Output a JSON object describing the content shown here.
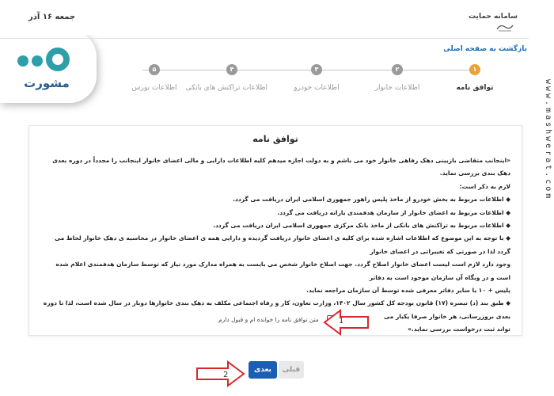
{
  "header": {
    "date": "جمعه ۱۶ آذر",
    "brand": "سامانه حمایت",
    "emblem": "ﻣﺤﺮﻡ"
  },
  "nav": {
    "back_label": "بازگشت به صفحه اصلی"
  },
  "logo": {
    "word": "مشورت"
  },
  "watermark": "www.mashwerat.com",
  "stepper": {
    "steps": [
      {
        "num": "۱",
        "label": "توافق نامه",
        "active": true
      },
      {
        "num": "۲",
        "label": "اطلاعات خانوار",
        "active": false
      },
      {
        "num": "۳",
        "label": "اطلاعات خودرو",
        "active": false
      },
      {
        "num": "۴",
        "label": "اطلاعات تراکنش های بانکی",
        "active": false
      },
      {
        "num": "۵",
        "label": "اطلاعات بورس",
        "active": false
      }
    ]
  },
  "agreement": {
    "title": "توافق نامه",
    "lines": [
      "«اینجانب متقاضی بازبینی دهک رفاهی خانوار خود می باشم و به دولت اجازه میدهم کلیه اطلاعات دارایی و مالی اعضای خانوار اینجانب را مجدداً در دوره بعدی دهک بندی بررسی نماید.",
      "لازم به ذکر است:",
      "◆ اطلاعات مربوط به بخش خودرو از ماخذ پلیس راهور جمهوری اسلامی ایران دریافت می گردد.",
      "◆ اطلاعات مربوط به اعضای خانوار از سازمان هدفمندی یارانه دریافت می گردد.",
      "◆ اطلاعات مربوط به تراکنش های بانکی از ماخذ بانک مرکزی جمهوری اسلامی ایران دریافت می گردد.",
      "◆ با توجه به این موضوع که اطلاعات اشاره شده برای کلیه ی اعضای خانوار دریافت گردیده و دارایی همه ی اعضای خانوار در محاسبه ی دهک خانوار لحاظ می گردد لذا در صورتی که تغییراتی در اعضای خانوار",
      "وجود دارد لازم است لیست اعضای خانوار اصلاح گردد. جهت اصلاح خانوار شخص می بایست به همراه مدارک مورد نیاز که توسط سازمان هدفمندی اعلام شده است و در وبگاه آن سازمان موجود است به دفاتر",
      "پلیس + ۱۰ یا سایر دفاتر معرفی شده توسط آن سازمان مراجعه نماید.",
      "◆ طبق بند (د) تبصره (۱۷) قانون بودجه کل کشور سال ۱۴۰۲، وزارت تعاون، کار و رفاه اجتماعی مکلف به دهک بندی خانوارها دوبار در سال شده است، لذا تا دوره بعدی بروزرسانی، هر خانوار صرفا یکبار می",
      "تواند ثبت درخواست بررسی نماید.»"
    ],
    "checkbox_label": "متن توافق نامه را خوانده ام و قبول دارم"
  },
  "buttons": {
    "next": "بعدی",
    "prev": "قبلی"
  },
  "annotations": {
    "arrow1": "1",
    "arrow2": "2"
  },
  "colors": {
    "accent": "#e8a33a",
    "primary": "#1a5fb4",
    "arrow": "#d9262a",
    "logo": "#2e9fa9"
  }
}
